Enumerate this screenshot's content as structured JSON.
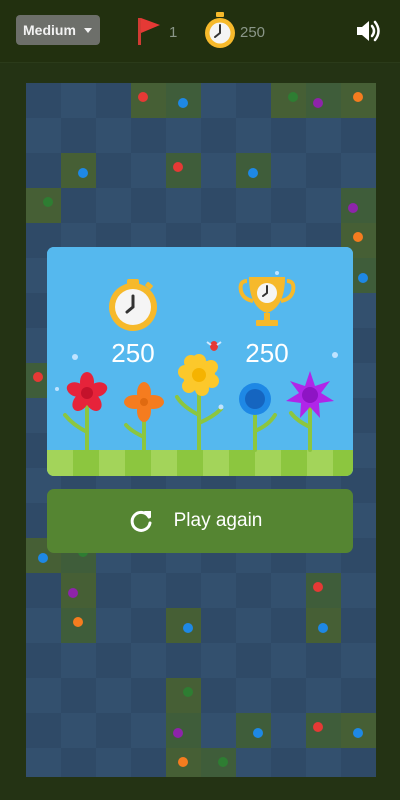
{
  "header": {
    "difficulty_label": "Medium",
    "flag_count": "1",
    "timer_value": "250"
  },
  "result": {
    "current_time": "250",
    "best_time": "250",
    "play_again_label": "Play again"
  },
  "icons": {
    "difficulty_caret": "chevron-down-icon",
    "flags": "flag-icon",
    "timer": "stopwatch-icon",
    "sound": "speaker-icon",
    "current_score": "stopwatch-icon",
    "best_score": "trophy-icon",
    "replay": "refresh-icon"
  },
  "colors": {
    "page_background": "#243314",
    "board_tile": "#2f4a67",
    "card_sky": "#55b8ee",
    "play_again_button": "#558532",
    "flag": "#e53935",
    "timer_gold": "#f6b92b"
  }
}
